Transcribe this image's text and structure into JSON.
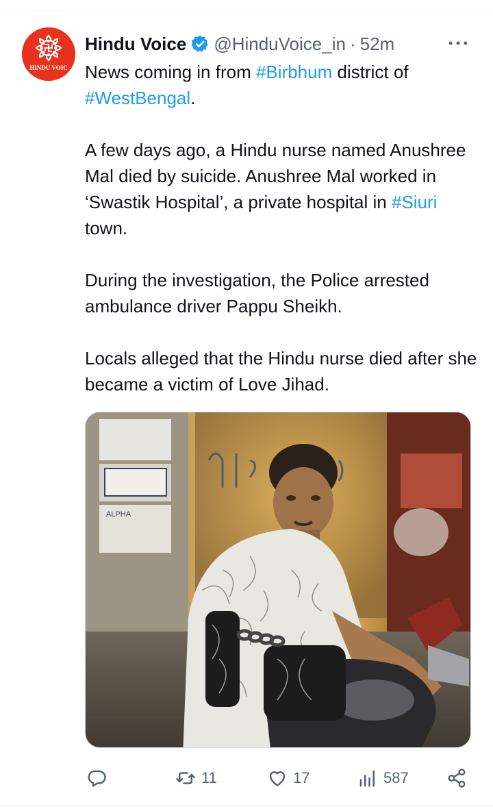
{
  "tweet": {
    "display_name": "Hindu Voice",
    "verified": true,
    "handle": "@HinduVoice_in",
    "separator": "·",
    "time": "52m",
    "avatar_text": "HINDU VOIC",
    "paragraphs": [
      [
        {
          "text": "News coming in from ",
          "hashtag": false
        },
        {
          "text": "#Birbhum",
          "hashtag": true
        },
        {
          "text": " district of ",
          "hashtag": false
        },
        {
          "text": "#WestBengal",
          "hashtag": true
        },
        {
          "text": ".",
          "hashtag": false
        }
      ],
      [
        {
          "text": "A few days ago, a Hindu nurse named Anushree Mal died by suicide. Anushree Mal worked in ‘Swastik Hospital’, a private hospital in ",
          "hashtag": false
        },
        {
          "text": "#Siuri",
          "hashtag": true
        },
        {
          "text": " town.",
          "hashtag": false
        }
      ],
      [
        {
          "text": "During the investigation, the Police arrested ambulance driver Pappu Sheikh.",
          "hashtag": false
        }
      ],
      [
        {
          "text": "Locals alleged that the Hindu nurse died after she became a victim of Love Jihad.",
          "hashtag": false
        }
      ]
    ],
    "media_alt": "Photo of a man in a patterned white shirt seated on a motorcycle beside a yellow wall with posters; handcuff graphic overlaid on his wrists",
    "poster_text": "ALPHA"
  },
  "actions": {
    "reply_count": "",
    "retweet_count": "11",
    "like_count": "17",
    "views_count": "587"
  },
  "colors": {
    "accent": "#1d9bf0",
    "text": "#0f1419",
    "muted": "#536471",
    "avatar_bg": "#e8321e"
  },
  "icons": {
    "verified": "verified-badge-icon",
    "more": "more-options-icon",
    "reply": "reply-icon",
    "retweet": "retweet-icon",
    "like": "heart-icon",
    "views": "views-bar-chart-icon",
    "share": "share-icon"
  }
}
